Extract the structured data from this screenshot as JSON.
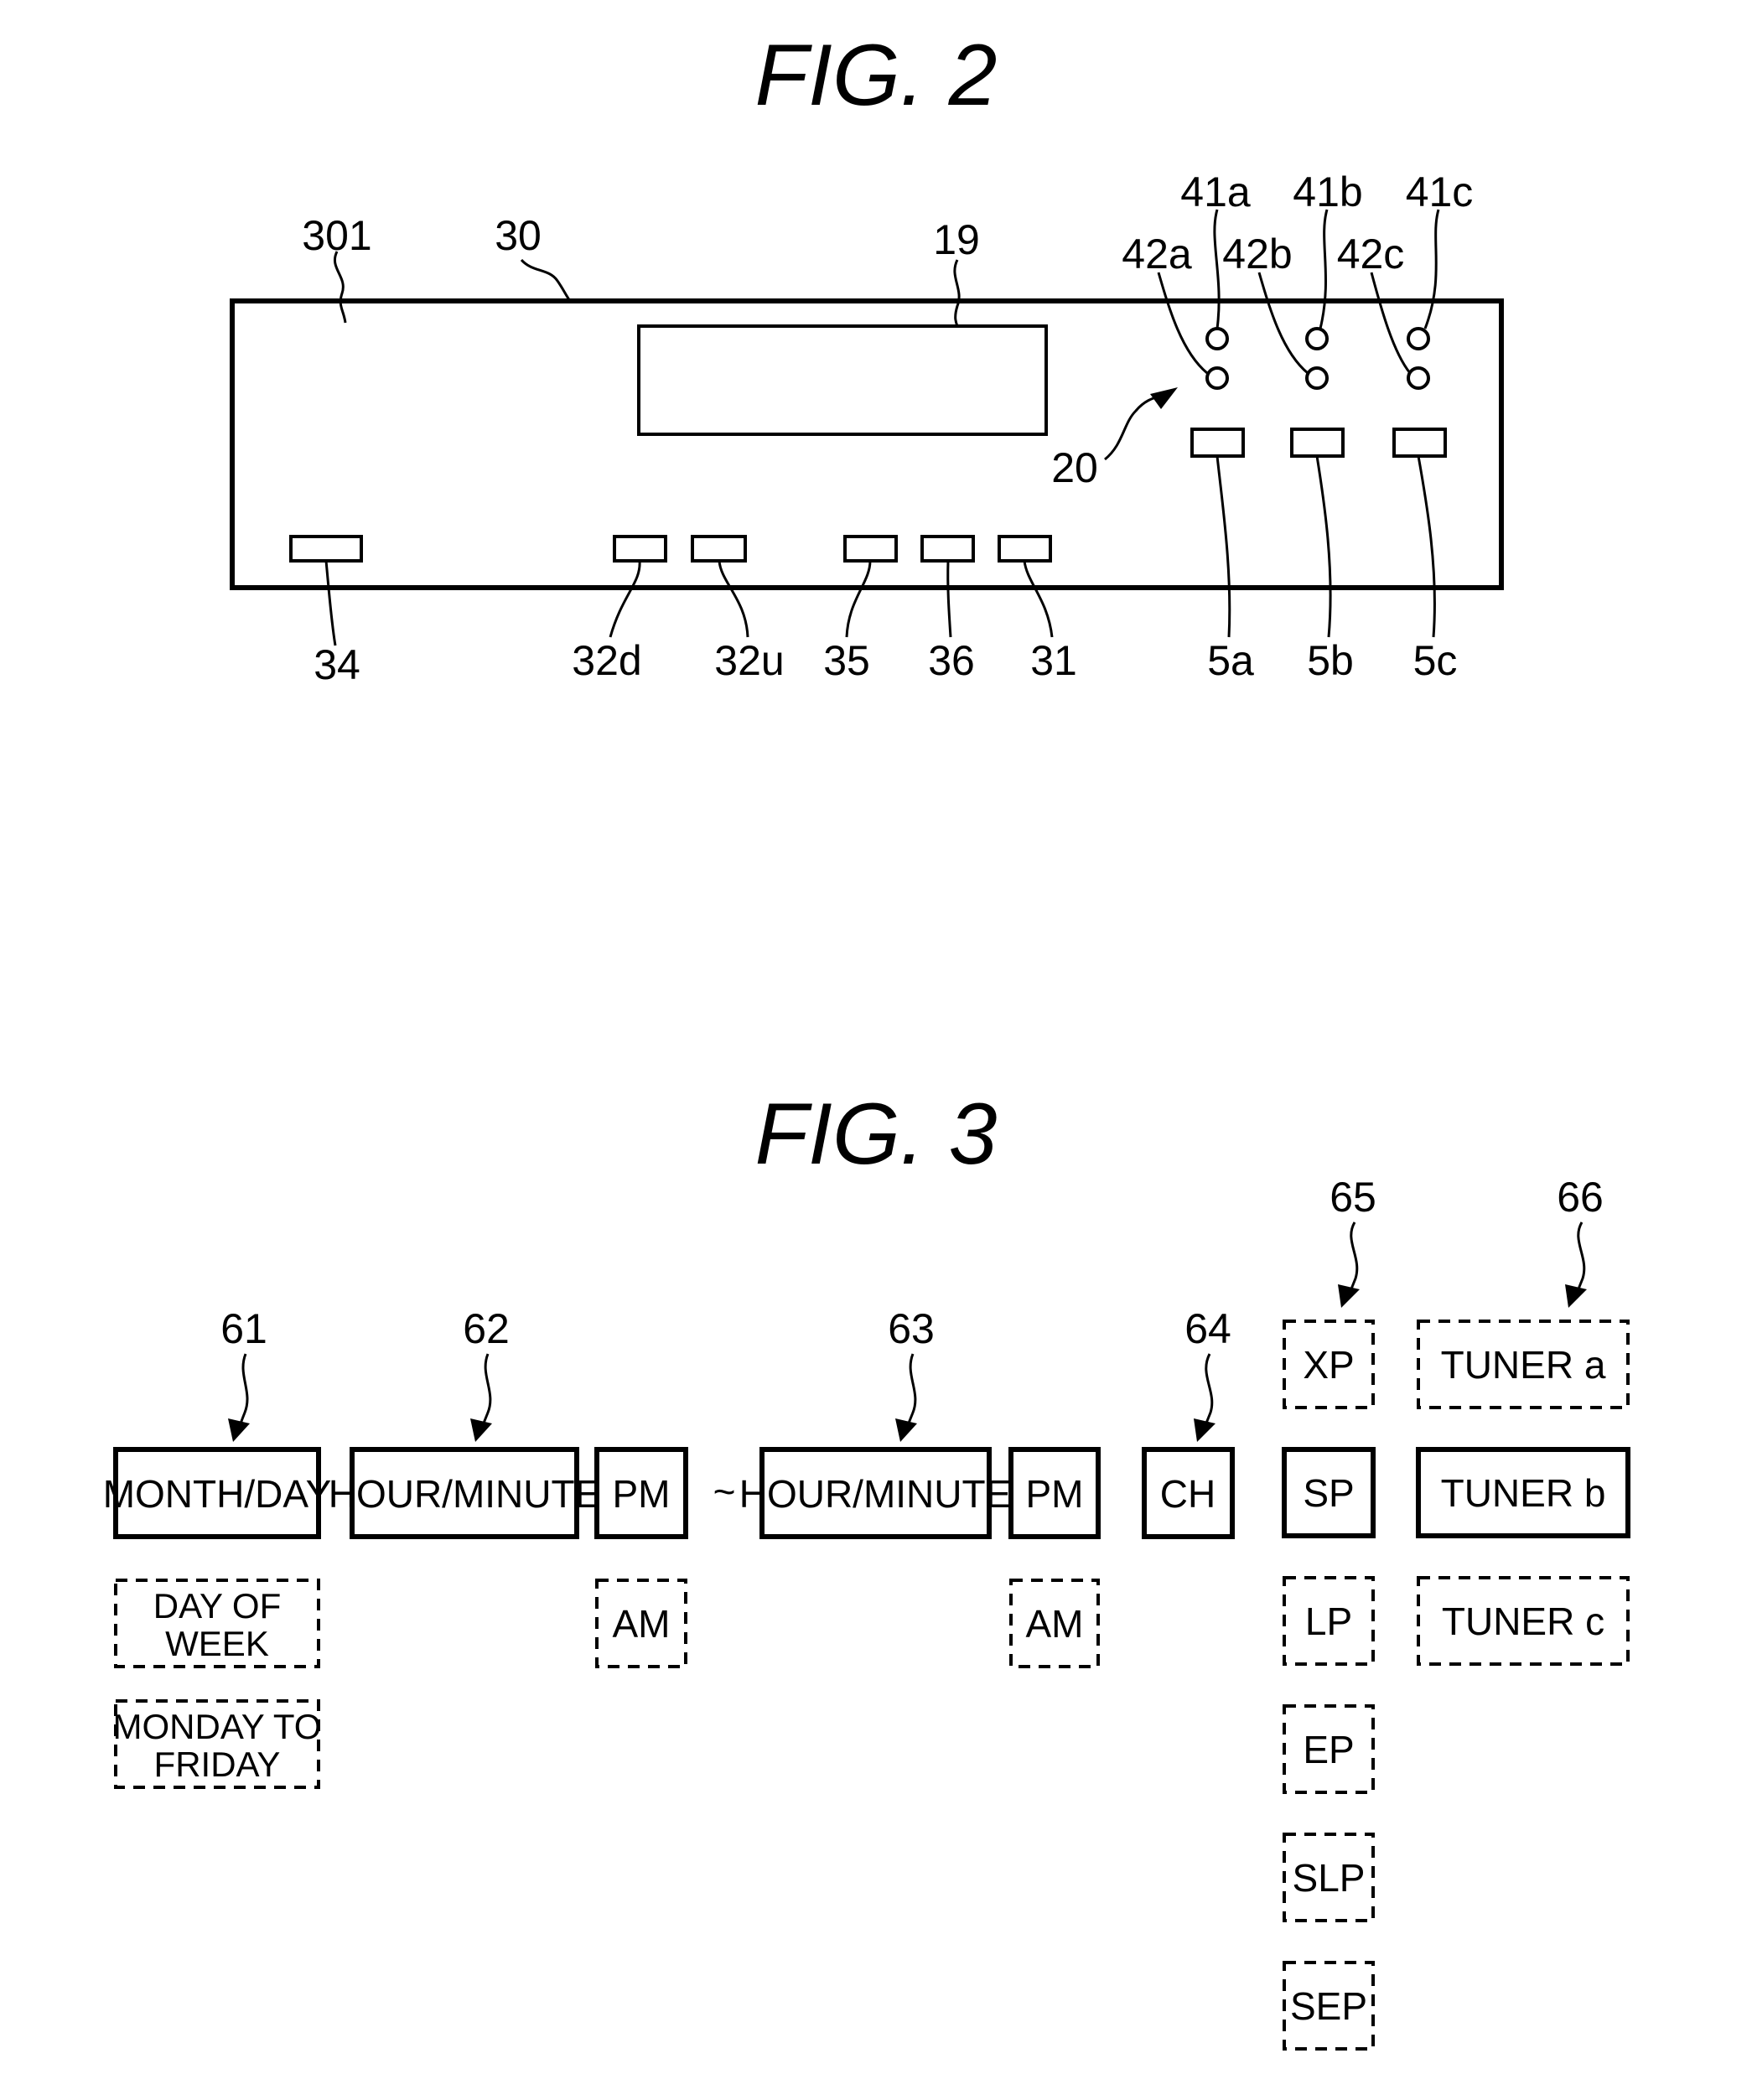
{
  "fig2": {
    "title": "FIG. 2",
    "labels": {
      "panel_surface": "301",
      "front_panel": "30",
      "display": "19",
      "indicator_group": "20",
      "led_41a": "41a",
      "led_41b": "41b",
      "led_41c": "41c",
      "led_42a": "42a",
      "led_42b": "42b",
      "led_42c": "42c",
      "button_34": "34",
      "button_32d": "32d",
      "button_32u": "32u",
      "button_35": "35",
      "button_36": "36",
      "button_31": "31",
      "button_5a": "5a",
      "button_5b": "5b",
      "button_5c": "5c"
    }
  },
  "fig3": {
    "title": "FIG. 3",
    "refs": {
      "r61": "61",
      "r62": "62",
      "r63": "63",
      "r64": "64",
      "r65": "65",
      "r66": "66"
    },
    "date_column": {
      "selected": "MONTH/DAY",
      "option_day_of_week_line1": "DAY OF",
      "option_day_of_week_line2": "WEEK",
      "option_weekdays_line1": "MONDAY TO",
      "option_weekdays_line2": "FRIDAY"
    },
    "start_time": {
      "value": "HOUR/MINUTE",
      "ampm_selected": "PM",
      "ampm_option": "AM"
    },
    "separator": "~",
    "end_time": {
      "value": "HOUR/MINUTE",
      "ampm_selected": "PM",
      "ampm_option": "AM"
    },
    "channel": "CH",
    "recording_mode": {
      "options": [
        "XP",
        "SP",
        "LP",
        "EP",
        "SLP",
        "SEP"
      ],
      "selected": "SP"
    },
    "tuner": {
      "options": [
        "TUNER a",
        "TUNER b",
        "TUNER c"
      ],
      "selected": "TUNER b"
    }
  }
}
